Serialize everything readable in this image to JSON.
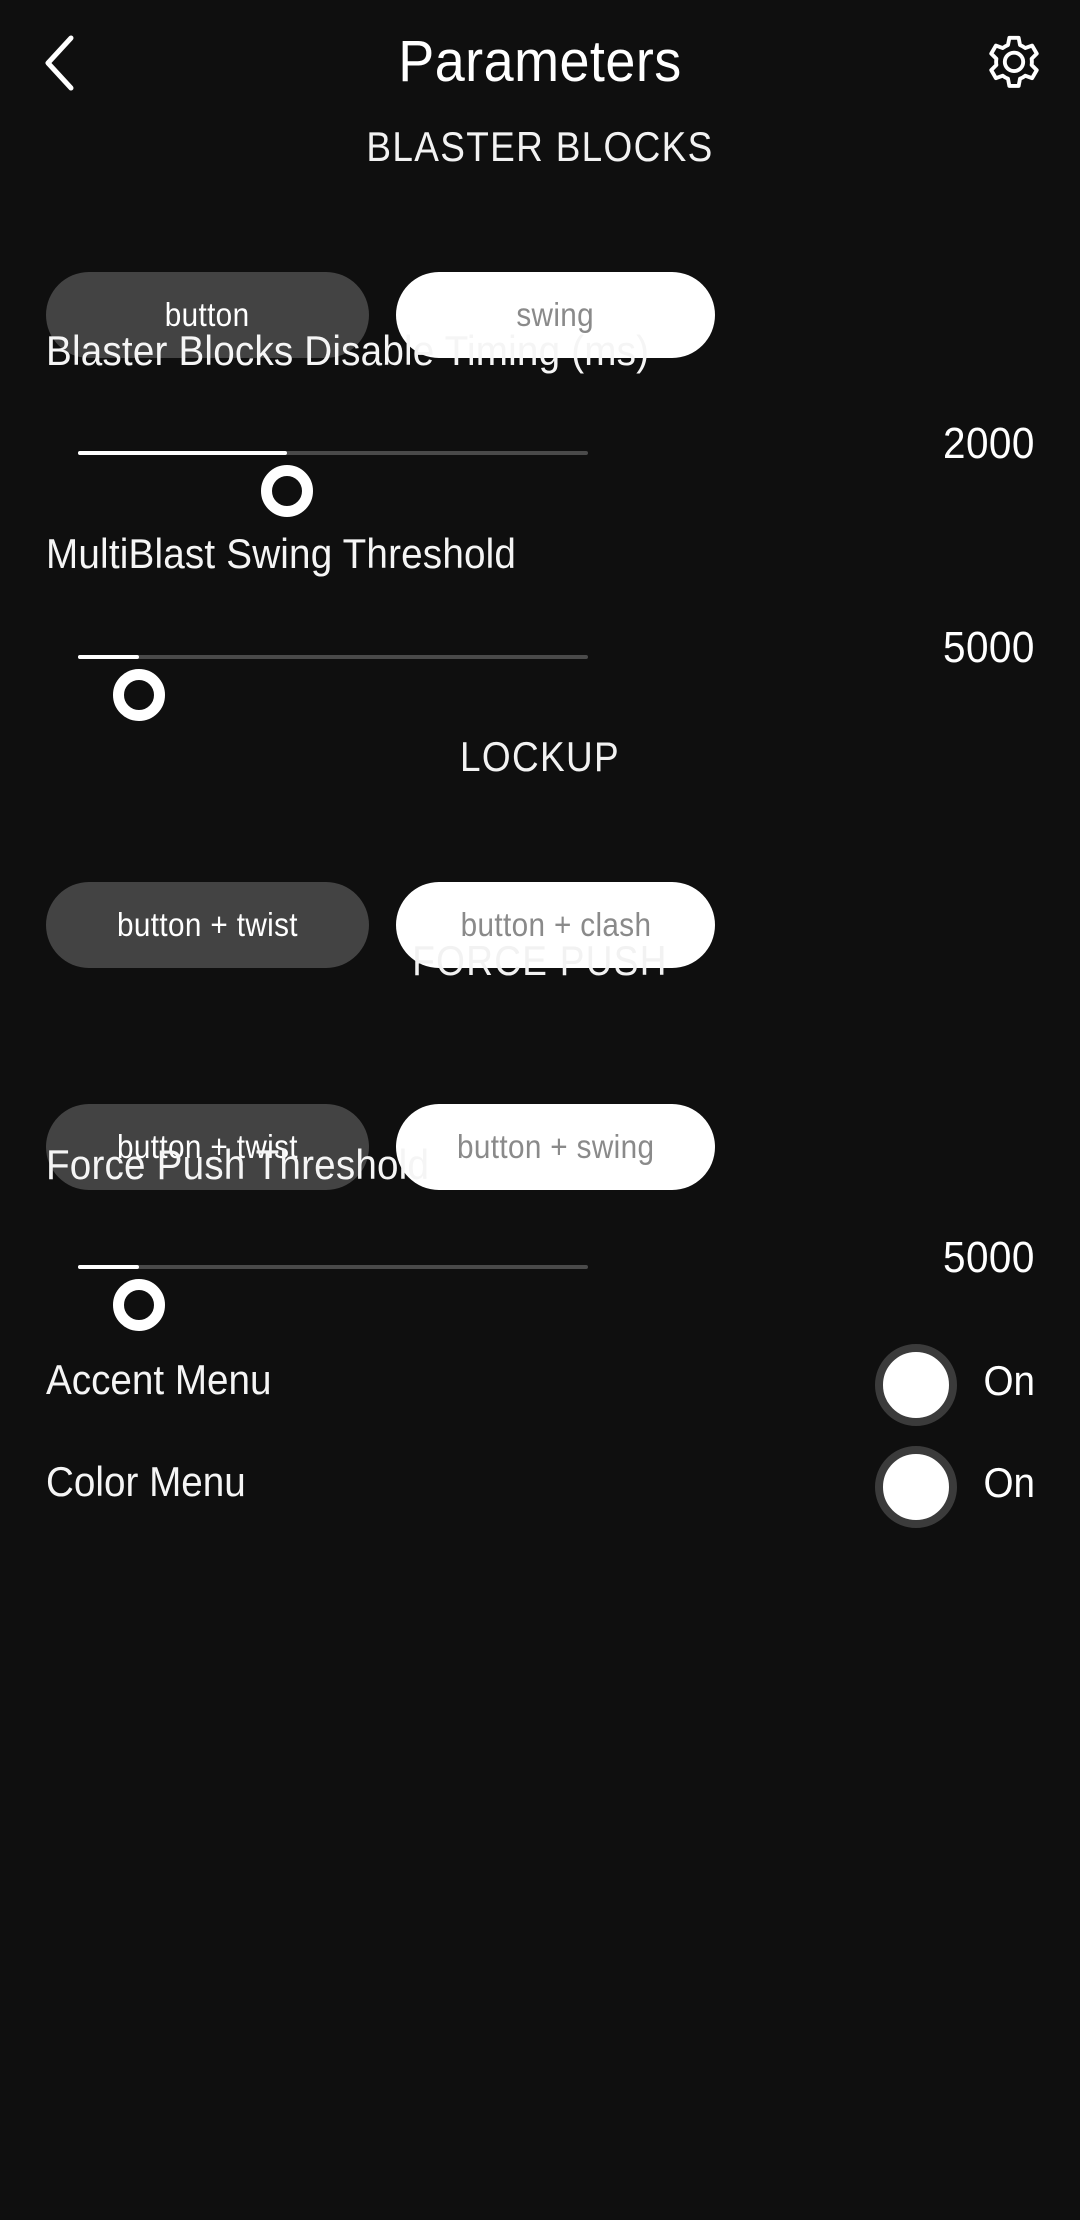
{
  "header": {
    "back_icon": "chevron-left-icon",
    "title": "Parameters",
    "settings_icon": "gear-icon"
  },
  "theme": {
    "background": "#0f0f0f",
    "selected_pill": "#434343",
    "unselected_pill": "#ffffff",
    "unselected_text": "#8a8a8a",
    "accent": "#ffffff",
    "track_inactive": "#4a4a4a"
  },
  "sections": {
    "blaster_blocks": {
      "heading": "BLASTER BLOCKS",
      "options": [
        {
          "label": "button",
          "selected": true
        },
        {
          "label": "swing",
          "selected": false
        }
      ]
    },
    "lockup": {
      "heading": "LOCKUP",
      "options": [
        {
          "label": "button + twist",
          "selected": true
        },
        {
          "label": "button + clash",
          "selected": false
        }
      ]
    },
    "force_push": {
      "heading": "FORCE PUSH",
      "options": [
        {
          "label": "button + twist",
          "selected": true
        },
        {
          "label": "button + swing",
          "selected": false
        }
      ]
    }
  },
  "sliders": [
    {
      "label": "Blaster Blocks Disable Timing (ms)",
      "value": "2000",
      "fill_percent": 41
    },
    {
      "label": "MultiBlast Swing Threshold",
      "value": "5000",
      "fill_percent": 12
    },
    {
      "label": "Force Push Threshold",
      "value": "5000",
      "fill_percent": 12
    }
  ],
  "switches": [
    {
      "label": "Accent Menu",
      "state": "On"
    },
    {
      "label": "Color Menu",
      "state": "On"
    }
  ]
}
